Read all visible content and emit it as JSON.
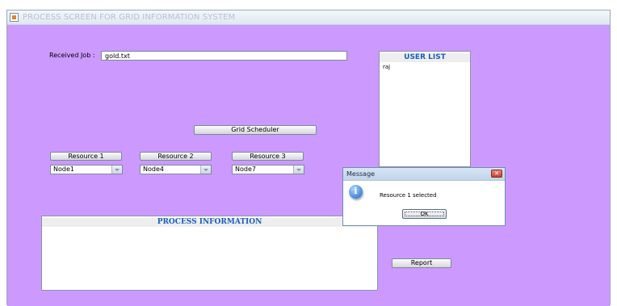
{
  "window": {
    "title": "PROCESS SCREEN FOR GRID INFORMATION SYSTEM"
  },
  "received_job": {
    "label": "Received Job :",
    "value": "gold.txt"
  },
  "grid_scheduler_button": "Grid Scheduler",
  "resources": [
    {
      "button": "Resource 1",
      "selected_node": "Node1"
    },
    {
      "button": "Resource 2",
      "selected_node": "Node4"
    },
    {
      "button": "Resource 3",
      "selected_node": "Node7"
    }
  ],
  "user_list": {
    "title": "USER LIST",
    "items": [
      "raj"
    ]
  },
  "process_information": {
    "title": "PROCESS INFORMATION",
    "content": ""
  },
  "report_button": "Report",
  "dialog": {
    "title": "Message",
    "message": "Resource 1 selected",
    "ok_label": "OK",
    "icon": "information-icon"
  },
  "colors": {
    "background": "#cc99ff",
    "panel_title": "#1a5fc0"
  }
}
